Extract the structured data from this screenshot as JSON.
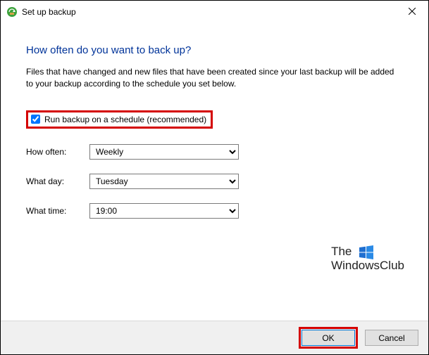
{
  "window": {
    "title": "Set up backup"
  },
  "main": {
    "heading": "How often do you want to back up?",
    "description": "Files that have changed and new files that have been created since your last backup will be added to your backup according to the schedule you set below.",
    "checkbox_label": "Run backup on a schedule (recommended)",
    "checkbox_checked": true,
    "fields": {
      "how_often": {
        "label": "How often:",
        "value": "Weekly"
      },
      "what_day": {
        "label": "What day:",
        "value": "Tuesday"
      },
      "what_time": {
        "label": "What time:",
        "value": "19:00"
      }
    }
  },
  "watermark": {
    "line1": "The",
    "line2": "WindowsClub"
  },
  "footer": {
    "ok": "OK",
    "cancel": "Cancel"
  }
}
